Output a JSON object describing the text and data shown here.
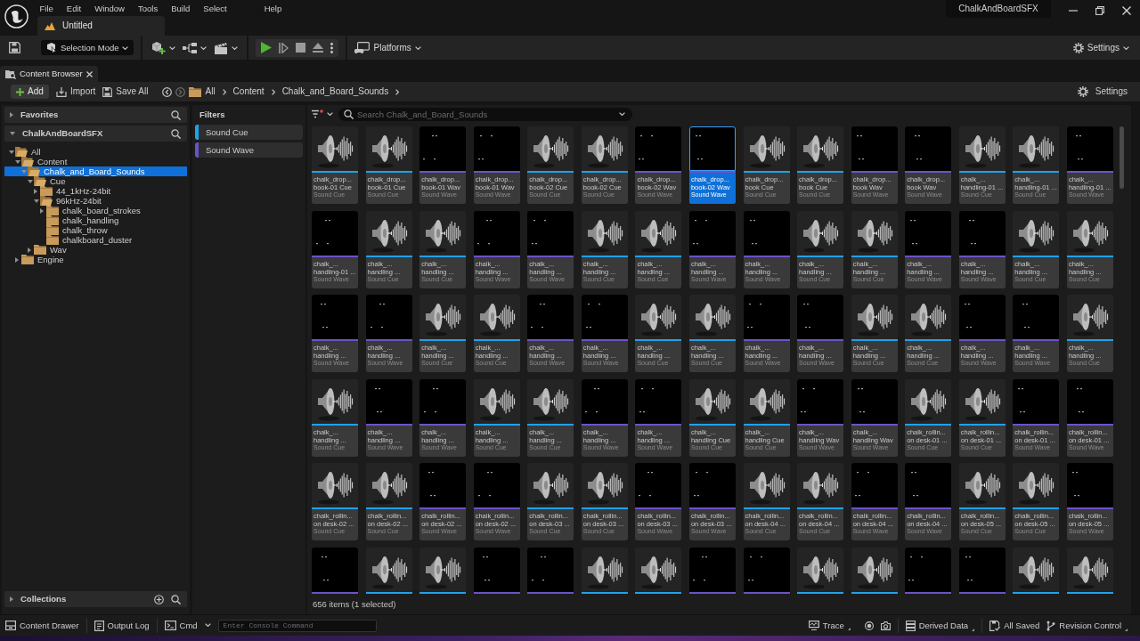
{
  "title_bar": {
    "menu": [
      "File",
      "Edit",
      "Window",
      "Tools",
      "Build",
      "Select",
      "Help"
    ],
    "document_tab": {
      "label": "Untitled",
      "selected": true
    },
    "project_name": "ChalkAndBoardSFX"
  },
  "main_toolbar": {
    "mode_dropdown": "Selection Mode",
    "platforms": "Platforms",
    "settings": "Settings"
  },
  "panel_tab": {
    "label": "Content Browser",
    "selected": true
  },
  "browser_toolbar": {
    "add": "Add",
    "import": "Import",
    "save_all": "Save All",
    "breadcrumb": [
      "All",
      "Content",
      "Chalk_and_Board_Sounds"
    ],
    "settings": "Settings"
  },
  "sources": {
    "favorites": {
      "label": "Favorites",
      "expanded": false
    },
    "project": {
      "label": "ChalkAndBoardSFX",
      "expanded": true
    },
    "tree": [
      {
        "label": "All",
        "expanded": true,
        "selected": false,
        "children": [
          {
            "label": "Content",
            "expanded": true,
            "selected": false,
            "children": [
              {
                "label": "Chalk_and_Board_Sounds",
                "expanded": true,
                "selected": true,
                "children": [
                  {
                    "label": "Cue",
                    "expanded": true,
                    "selected": false,
                    "children": [
                      {
                        "label": "44_1kHz-24bit",
                        "expanded": false,
                        "selected": false
                      },
                      {
                        "label": "96kHz-24bit",
                        "expanded": true,
                        "selected": false,
                        "children": [
                          {
                            "label": "chalk_board_strokes",
                            "expanded": false,
                            "selected": false
                          },
                          {
                            "label": "chalk_handling",
                            "selected": false
                          },
                          {
                            "label": "chalk_throw",
                            "selected": false
                          },
                          {
                            "label": "chalkboard_duster",
                            "selected": false
                          }
                        ]
                      }
                    ]
                  },
                  {
                    "label": "Wav",
                    "expanded": false,
                    "selected": false
                  }
                ]
              }
            ]
          },
          {
            "label": "Engine",
            "expanded": false,
            "selected": false
          }
        ]
      }
    ],
    "collections": {
      "label": "Collections",
      "expanded": false
    }
  },
  "filters": {
    "title": "Filters",
    "items": [
      {
        "label": "Sound Cue",
        "kind": "cue",
        "color": "#1ea2ea"
      },
      {
        "label": "Sound Wave",
        "kind": "wave",
        "color": "#6c52c8"
      }
    ]
  },
  "assets": {
    "search": {
      "placeholder": "Search Chalk_and_Board_Sounds"
    },
    "tiles": [
      {
        "kind": "cue",
        "name_lines": [
          "chalk_drop...",
          "book-01 Cue"
        ],
        "type": "Sound Cue",
        "selected": false
      },
      {
        "kind": "cue",
        "name_lines": [
          "chalk_drop...",
          "book-01 Cue"
        ],
        "type": "Sound Cue",
        "selected": false
      },
      {
        "kind": "wave",
        "name_lines": [
          "chalk_drop...",
          "book-01 Wav"
        ],
        "type": "Sound Wave",
        "selected": false
      },
      {
        "kind": "wave",
        "name_lines": [
          "chalk_drop...",
          "book-01 Wav"
        ],
        "type": "Sound Wave",
        "selected": false
      },
      {
        "kind": "cue",
        "name_lines": [
          "chalk_drop...",
          "book-02 Cue"
        ],
        "type": "Sound Cue",
        "selected": false
      },
      {
        "kind": "cue",
        "name_lines": [
          "chalk_drop...",
          "book-02 Cue"
        ],
        "type": "Sound Cue",
        "selected": false
      },
      {
        "kind": "wave",
        "name_lines": [
          "chalk_drop...",
          "book-02 Wav"
        ],
        "type": "Sound Wave",
        "selected": false
      },
      {
        "kind": "wave",
        "name_lines": [
          "chalk_drop...",
          "book-02 Wav"
        ],
        "type": "Sound Wave",
        "selected": true
      },
      {
        "kind": "cue",
        "name_lines": [
          "chalk_drop...",
          "book Cue"
        ],
        "type": "Sound Cue",
        "selected": false
      },
      {
        "kind": "cue",
        "name_lines": [
          "chalk_drop...",
          "book Cue"
        ],
        "type": "Sound Cue",
        "selected": false
      },
      {
        "kind": "wave",
        "name_lines": [
          "chalk_drop...",
          "book Wav"
        ],
        "type": "Sound Wave",
        "selected": false
      },
      {
        "kind": "wave",
        "name_lines": [
          "chalk_drop...",
          "book Wav"
        ],
        "type": "Sound Wave",
        "selected": false
      },
      {
        "kind": "cue",
        "name_lines": [
          "chalk_...",
          "handling-01 ..."
        ],
        "type": "Sound Cue",
        "selected": false
      },
      {
        "kind": "cue",
        "name_lines": [
          "chalk_...",
          "handling-01 ..."
        ],
        "type": "Sound Cue",
        "selected": false
      },
      {
        "kind": "wave",
        "name_lines": [
          "chalk_...",
          "handling-01 ..."
        ],
        "type": "Sound Wave",
        "selected": false
      },
      {
        "kind": "wave",
        "name_lines": [
          "chalk_...",
          "handling-01 ..."
        ],
        "type": "Sound Wave",
        "selected": false
      },
      {
        "kind": "cue",
        "name_lines": [
          "chalk_...",
          "handling ..."
        ],
        "type": "Sound Cue",
        "selected": false
      },
      {
        "kind": "cue",
        "name_lines": [
          "chalk_...",
          "handling ..."
        ],
        "type": "Sound Cue",
        "selected": false
      },
      {
        "kind": "wave",
        "name_lines": [
          "chalk_...",
          "handling ..."
        ],
        "type": "Sound Wave",
        "selected": false
      },
      {
        "kind": "wave",
        "name_lines": [
          "chalk_...",
          "handling ..."
        ],
        "type": "Sound Wave",
        "selected": false
      },
      {
        "kind": "cue",
        "name_lines": [
          "chalk_...",
          "handling ..."
        ],
        "type": "Sound Cue",
        "selected": false
      },
      {
        "kind": "cue",
        "name_lines": [
          "chalk_...",
          "handling ..."
        ],
        "type": "Sound Cue",
        "selected": false
      },
      {
        "kind": "wave",
        "name_lines": [
          "chalk_...",
          "handling ..."
        ],
        "type": "Sound Wave",
        "selected": false
      },
      {
        "kind": "wave",
        "name_lines": [
          "chalk_...",
          "handling ..."
        ],
        "type": "Sound Wave",
        "selected": false
      },
      {
        "kind": "cue",
        "name_lines": [
          "chalk_...",
          "handling ..."
        ],
        "type": "Sound Cue",
        "selected": false
      },
      {
        "kind": "cue",
        "name_lines": [
          "chalk_...",
          "handling ..."
        ],
        "type": "Sound Cue",
        "selected": false
      },
      {
        "kind": "wave",
        "name_lines": [
          "chalk_...",
          "handling ..."
        ],
        "type": "Sound Wave",
        "selected": false
      },
      {
        "kind": "wave",
        "name_lines": [
          "chalk_...",
          "handling ..."
        ],
        "type": "Sound Wave",
        "selected": false
      },
      {
        "kind": "cue",
        "name_lines": [
          "chalk_...",
          "handling ..."
        ],
        "type": "Sound Cue",
        "selected": false
      },
      {
        "kind": "cue",
        "name_lines": [
          "chalk_...",
          "handling ..."
        ],
        "type": "Sound Cue",
        "selected": false
      },
      {
        "kind": "wave",
        "name_lines": [
          "chalk_...",
          "handling ..."
        ],
        "type": "Sound Wave",
        "selected": false
      },
      {
        "kind": "wave",
        "name_lines": [
          "chalk_...",
          "handling ..."
        ],
        "type": "Sound Wave",
        "selected": false
      },
      {
        "kind": "cue",
        "name_lines": [
          "chalk_...",
          "handling ..."
        ],
        "type": "Sound Cue",
        "selected": false
      },
      {
        "kind": "cue",
        "name_lines": [
          "chalk_...",
          "handling ..."
        ],
        "type": "Sound Cue",
        "selected": false
      },
      {
        "kind": "wave",
        "name_lines": [
          "chalk_...",
          "handling ..."
        ],
        "type": "Sound Wave",
        "selected": false
      },
      {
        "kind": "wave",
        "name_lines": [
          "chalk_...",
          "handling ..."
        ],
        "type": "Sound Wave",
        "selected": false
      },
      {
        "kind": "cue",
        "name_lines": [
          "chalk_...",
          "handling ..."
        ],
        "type": "Sound Cue",
        "selected": false
      },
      {
        "kind": "cue",
        "name_lines": [
          "chalk_...",
          "handling ..."
        ],
        "type": "Sound Cue",
        "selected": false
      },
      {
        "kind": "wave",
        "name_lines": [
          "chalk_...",
          "handling ..."
        ],
        "type": "Sound Wave",
        "selected": false
      },
      {
        "kind": "wave",
        "name_lines": [
          "chalk_...",
          "handling ..."
        ],
        "type": "Sound Wave",
        "selected": false
      },
      {
        "kind": "cue",
        "name_lines": [
          "chalk_...",
          "handling ..."
        ],
        "type": "Sound Cue",
        "selected": false
      },
      {
        "kind": "cue",
        "name_lines": [
          "chalk_...",
          "handling ..."
        ],
        "type": "Sound Cue",
        "selected": false
      },
      {
        "kind": "wave",
        "name_lines": [
          "chalk_...",
          "handling ..."
        ],
        "type": "Sound Wave",
        "selected": false
      },
      {
        "kind": "wave",
        "name_lines": [
          "chalk_...",
          "handling ..."
        ],
        "type": "Sound Wave",
        "selected": false
      },
      {
        "kind": "cue",
        "name_lines": [
          "chalk_...",
          "handling ..."
        ],
        "type": "Sound Cue",
        "selected": false
      },
      {
        "kind": "cue",
        "name_lines": [
          "chalk_...",
          "handling ..."
        ],
        "type": "Sound Cue",
        "selected": false
      },
      {
        "kind": "wave",
        "name_lines": [
          "chalk_...",
          "handling ..."
        ],
        "type": "Sound Wave",
        "selected": false
      },
      {
        "kind": "wave",
        "name_lines": [
          "chalk_...",
          "handling ..."
        ],
        "type": "Sound Wave",
        "selected": false
      },
      {
        "kind": "cue",
        "name_lines": [
          "chalk_...",
          "handling ..."
        ],
        "type": "Sound Cue",
        "selected": false
      },
      {
        "kind": "cue",
        "name_lines": [
          "chalk_...",
          "handling ..."
        ],
        "type": "Sound Cue",
        "selected": false
      },
      {
        "kind": "wave",
        "name_lines": [
          "chalk_...",
          "handling ..."
        ],
        "type": "Sound Wave",
        "selected": false
      },
      {
        "kind": "wave",
        "name_lines": [
          "chalk_...",
          "handling ..."
        ],
        "type": "Sound Wave",
        "selected": false
      },
      {
        "kind": "cue",
        "name_lines": [
          "chalk_...",
          "handling Cue"
        ],
        "type": "Sound Cue",
        "selected": false
      },
      {
        "kind": "cue",
        "name_lines": [
          "chalk_...",
          "handling Cue"
        ],
        "type": "Sound Cue",
        "selected": false
      },
      {
        "kind": "wave",
        "name_lines": [
          "chalk_...",
          "handling Wav"
        ],
        "type": "Sound Wave",
        "selected": false
      },
      {
        "kind": "wave",
        "name_lines": [
          "chalk_...",
          "handling Wav"
        ],
        "type": "Sound Wave",
        "selected": false
      },
      {
        "kind": "cue",
        "name_lines": [
          "chalk_rollin...",
          "on desk-01 ..."
        ],
        "type": "Sound Cue",
        "selected": false
      },
      {
        "kind": "cue",
        "name_lines": [
          "chalk_rollin...",
          "on desk-01 ..."
        ],
        "type": "Sound Cue",
        "selected": false
      },
      {
        "kind": "wave",
        "name_lines": [
          "chalk_rollin...",
          "on desk-01 ..."
        ],
        "type": "Sound Wave",
        "selected": false
      },
      {
        "kind": "wave",
        "name_lines": [
          "chalk_rollin...",
          "on desk-01 ..."
        ],
        "type": "Sound Wave",
        "selected": false
      },
      {
        "kind": "cue",
        "name_lines": [
          "chalk_rollin...",
          "on desk-02 ..."
        ],
        "type": "Sound Cue",
        "selected": false
      },
      {
        "kind": "cue",
        "name_lines": [
          "chalk_rollin...",
          "on desk-02 ..."
        ],
        "type": "Sound Cue",
        "selected": false
      },
      {
        "kind": "wave",
        "name_lines": [
          "chalk_rollin...",
          "on desk-02 ..."
        ],
        "type": "Sound Wave",
        "selected": false
      },
      {
        "kind": "wave",
        "name_lines": [
          "chalk_rollin...",
          "on desk-02 ..."
        ],
        "type": "Sound Wave",
        "selected": false
      },
      {
        "kind": "cue",
        "name_lines": [
          "chalk_rollin...",
          "on desk-03 ..."
        ],
        "type": "Sound Cue",
        "selected": false
      },
      {
        "kind": "cue",
        "name_lines": [
          "chalk_rollin...",
          "on desk-03 ..."
        ],
        "type": "Sound Cue",
        "selected": false
      },
      {
        "kind": "wave",
        "name_lines": [
          "chalk_rollin...",
          "on desk-03 ..."
        ],
        "type": "Sound Wave",
        "selected": false
      },
      {
        "kind": "wave",
        "name_lines": [
          "chalk_rollin...",
          "on desk-03 ..."
        ],
        "type": "Sound Wave",
        "selected": false
      },
      {
        "kind": "cue",
        "name_lines": [
          "chalk_rollin...",
          "on desk-04 ..."
        ],
        "type": "Sound Cue",
        "selected": false
      },
      {
        "kind": "cue",
        "name_lines": [
          "chalk_rollin...",
          "on desk-04 ..."
        ],
        "type": "Sound Cue",
        "selected": false
      },
      {
        "kind": "wave",
        "name_lines": [
          "chalk_rollin...",
          "on desk-04 ..."
        ],
        "type": "Sound Wave",
        "selected": false
      },
      {
        "kind": "wave",
        "name_lines": [
          "chalk_rollin...",
          "on desk-04 ..."
        ],
        "type": "Sound Wave",
        "selected": false
      },
      {
        "kind": "cue",
        "name_lines": [
          "chalk_rollin...",
          "on desk-05 ..."
        ],
        "type": "Sound Cue",
        "selected": false
      },
      {
        "kind": "cue",
        "name_lines": [
          "chalk_rollin...",
          "on desk-05 ..."
        ],
        "type": "Sound Cue",
        "selected": false
      },
      {
        "kind": "wave",
        "name_lines": [
          "chalk_rollin...",
          "on desk-05 ..."
        ],
        "type": "Sound Wave",
        "selected": false
      },
      {
        "kind": "wave",
        "selected": false
      },
      {
        "kind": "cue",
        "selected": false
      },
      {
        "kind": "cue",
        "selected": false
      },
      {
        "kind": "wave",
        "selected": false
      },
      {
        "kind": "wave",
        "selected": false
      },
      {
        "kind": "cue",
        "selected": false
      },
      {
        "kind": "cue",
        "selected": false
      },
      {
        "kind": "wave",
        "selected": false
      },
      {
        "kind": "wave",
        "selected": false
      },
      {
        "kind": "cue",
        "selected": false
      },
      {
        "kind": "cue",
        "selected": false
      },
      {
        "kind": "wave",
        "selected": false
      },
      {
        "kind": "wave",
        "selected": false
      },
      {
        "kind": "cue",
        "selected": false
      },
      {
        "kind": "cue",
        "selected": false
      }
    ],
    "status": "656 items (1 selected)"
  },
  "status_bar": {
    "content_drawer": "Content Drawer",
    "output_log": "Output Log",
    "cmd": "Cmd",
    "console": {
      "placeholder": "Enter Console Command"
    },
    "trace": "Trace",
    "derived_data": "Derived Data",
    "all_saved": "All Saved",
    "revision_control": "Revision Control"
  }
}
